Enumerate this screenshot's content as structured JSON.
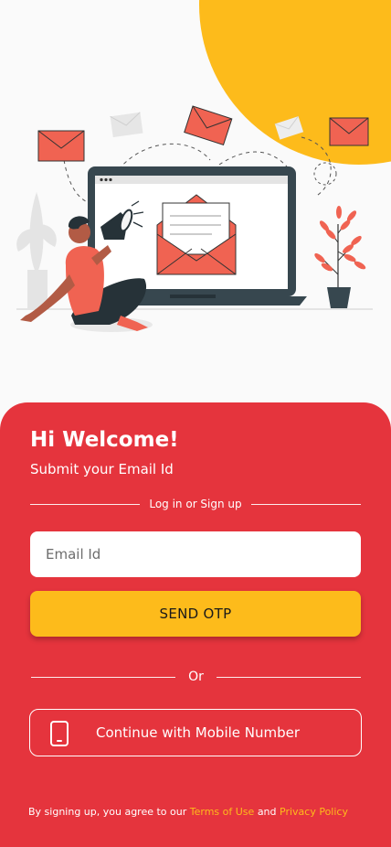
{
  "hero": {
    "illustration": "man-with-megaphone-laptop-email-illustration",
    "colors": {
      "sun": "#fdbb1b",
      "envelope": "#f06352",
      "laptop": "#37474f"
    }
  },
  "panel": {
    "background": "#e5343d",
    "greeting": "Hi Welcome!",
    "subtitle": "Submit your Email Id",
    "divider_text": "Log in or Sign up",
    "email_input": {
      "placeholder": "Email Id",
      "value": ""
    },
    "send_otp_label": "SEND OTP",
    "or_text": "Or",
    "mobile_button": {
      "icon": "phone-icon",
      "label": "Continue with Mobile Number"
    },
    "terms": {
      "prefix": "By signing up, you agree to our",
      "terms_link": "Terms of Use",
      "joiner": "and",
      "privacy_link": "Privacy Policy"
    }
  }
}
